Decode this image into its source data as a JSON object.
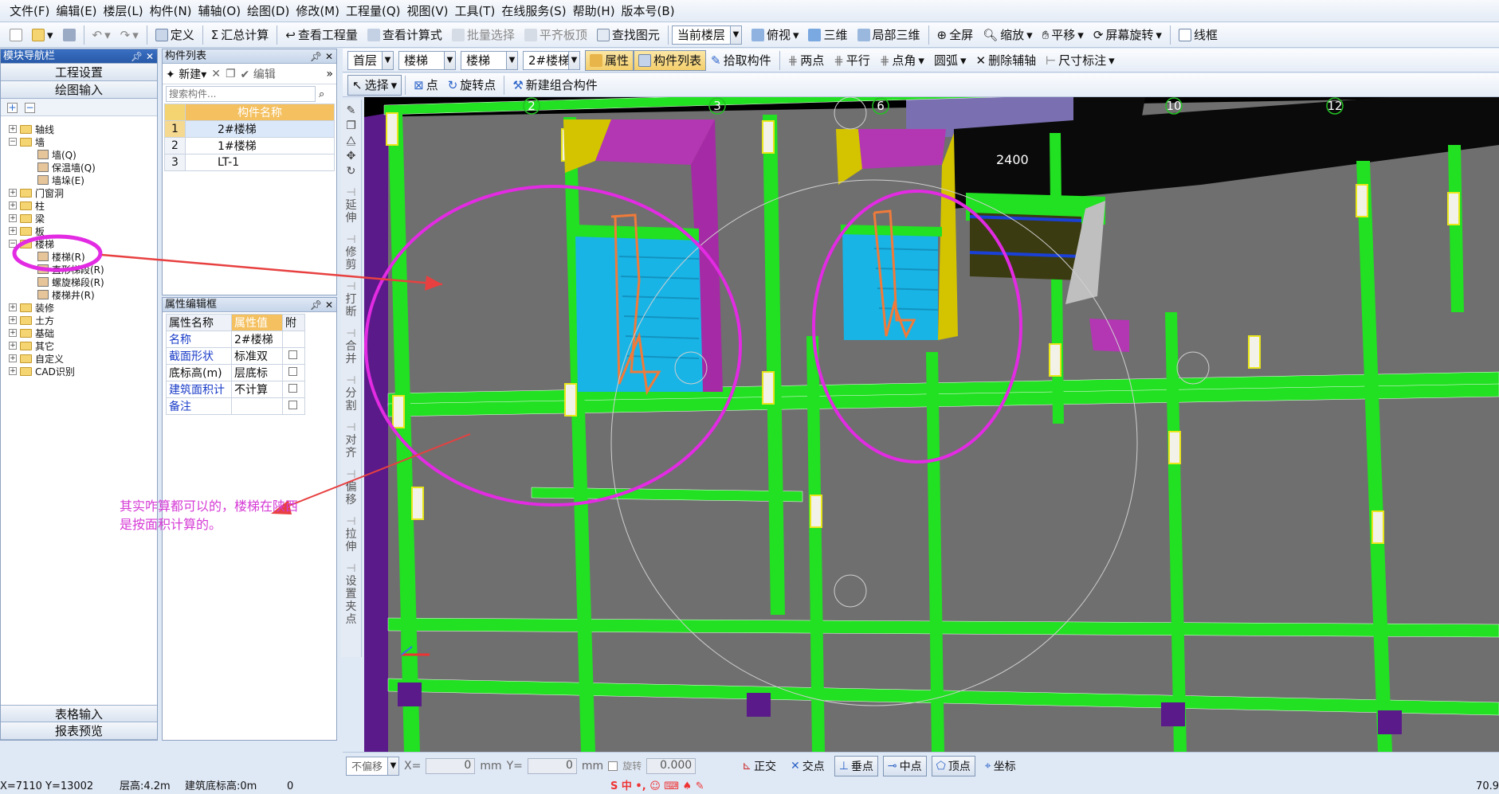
{
  "menu": [
    "文件(F)",
    "编辑(E)",
    "楼层(L)",
    "构件(N)",
    "辅轴(O)",
    "绘图(D)",
    "修改(M)",
    "工程量(Q)",
    "视图(V)",
    "工具(T)",
    "在线服务(S)",
    "帮助(H)",
    "版本号(B)"
  ],
  "toolbar1": {
    "define": "定义",
    "sum_calc": "汇总计算",
    "view_qty": "查看工程量",
    "view_formula": "查看计算式",
    "batch_select": "批量选择",
    "align_slab": "平齐板顶",
    "find_elem": "查找图元",
    "floor_dropdown": "当前楼层",
    "top_view": "俯视",
    "three_d": "三维",
    "local_3d": "局部三维",
    "fullscreen": "全屏",
    "zoom": "缩放",
    "pan": "平移",
    "rotate": "屏幕旋转",
    "wireframe": "线框"
  },
  "toolbar2": {
    "floor": "首层",
    "type1": "楼梯",
    "type2": "楼梯",
    "component": "2#楼梯",
    "props": "属性",
    "comp_list": "构件列表",
    "pick": "拾取构件",
    "two_point": "两点",
    "parallel": "平行",
    "point_angle": "点角",
    "arc": "圆弧",
    "del_aux": "删除辅轴",
    "dimension": "尺寸标注"
  },
  "toolbar3": {
    "select": "选择",
    "point": "点",
    "rotate_point": "旋转点",
    "new_combo": "新建组合构件"
  },
  "nav": {
    "title": "模块导航栏",
    "project_settings": "工程设置",
    "drawing_input": "绘图输入",
    "table_input": "表格输入",
    "report_preview": "报表预览",
    "tree": [
      {
        "label": "轴线",
        "level": 0,
        "type": "folder"
      },
      {
        "label": "墙",
        "level": 0,
        "type": "folder"
      },
      {
        "label": "墙(Q)",
        "level": 1,
        "type": "leaf"
      },
      {
        "label": "保温墙(Q)",
        "level": 1,
        "type": "leaf"
      },
      {
        "label": "墙垛(E)",
        "level": 1,
        "type": "leaf"
      },
      {
        "label": "门窗洞",
        "level": 0,
        "type": "folder"
      },
      {
        "label": "柱",
        "level": 0,
        "type": "folder"
      },
      {
        "label": "梁",
        "level": 0,
        "type": "folder"
      },
      {
        "label": "板",
        "level": 0,
        "type": "folder"
      },
      {
        "label": "楼梯",
        "level": 0,
        "type": "folder"
      },
      {
        "label": "楼梯(R)",
        "level": 1,
        "type": "leaf"
      },
      {
        "label": "直形梯段(R)",
        "level": 1,
        "type": "leaf"
      },
      {
        "label": "螺旋梯段(R)",
        "level": 1,
        "type": "leaf"
      },
      {
        "label": "楼梯井(R)",
        "level": 1,
        "type": "leaf"
      },
      {
        "label": "装修",
        "level": 0,
        "type": "folder"
      },
      {
        "label": "土方",
        "level": 0,
        "type": "folder"
      },
      {
        "label": "基础",
        "level": 0,
        "type": "folder"
      },
      {
        "label": "其它",
        "level": 0,
        "type": "folder"
      },
      {
        "label": "自定义",
        "level": 0,
        "type": "folder"
      },
      {
        "label": "CAD识别",
        "level": 0,
        "type": "folder"
      }
    ]
  },
  "comp_list": {
    "title": "构件列表",
    "new_btn": "新建",
    "edit_btn": "编辑",
    "search_placeholder": "搜索构件...",
    "col_header": "构件名称",
    "rows": [
      {
        "no": "1",
        "name": "2#楼梯"
      },
      {
        "no": "2",
        "name": "1#楼梯"
      },
      {
        "no": "3",
        "name": "LT-1"
      }
    ]
  },
  "props": {
    "title": "属性编辑框",
    "headers": [
      "属性名称",
      "属性值",
      "附"
    ],
    "rows": [
      {
        "name": "名称",
        "value": "2#楼梯"
      },
      {
        "name": "截面形状",
        "value": "标准双"
      },
      {
        "name": "底标高(m)",
        "value": "层底标"
      },
      {
        "name": "建筑面积计",
        "value": "不计算"
      },
      {
        "name": "备注",
        "value": ""
      }
    ]
  },
  "vtools": [
    "延伸",
    "修剪",
    "打断",
    "合并",
    "分割",
    "对齐",
    "偏移",
    "拉伸",
    "设置夹点"
  ],
  "canvas": {
    "axis_labels": [
      "2",
      "3",
      "6",
      "10",
      "12"
    ],
    "dim_text": "2400",
    "annotation": [
      "其实咋算都可以的，楼梯在陕西",
      "是按面积计算的。"
    ]
  },
  "bottom_bar": {
    "mode": "不偏移",
    "x_label": "X=",
    "x_value": "0",
    "y_label": "Y=",
    "y_value": "0",
    "unit": "mm",
    "rotate_label": "旋转",
    "rotate_value": "0.000",
    "snaps": [
      "正交",
      "交点",
      "垂点",
      "中点",
      "顶点",
      "坐标"
    ]
  },
  "status": {
    "coords": "X=7110 Y=13002",
    "floor_height": "层高:4.2m",
    "base_elev": "建筑底标高:0m",
    "zero": "0",
    "right_value": "70.9"
  },
  "colors": {
    "magenta": "#e22be2",
    "green": "#22e022",
    "yellow": "#e9e61a",
    "cyan": "#1ab7e9",
    "gray": "#6f6f6f"
  }
}
